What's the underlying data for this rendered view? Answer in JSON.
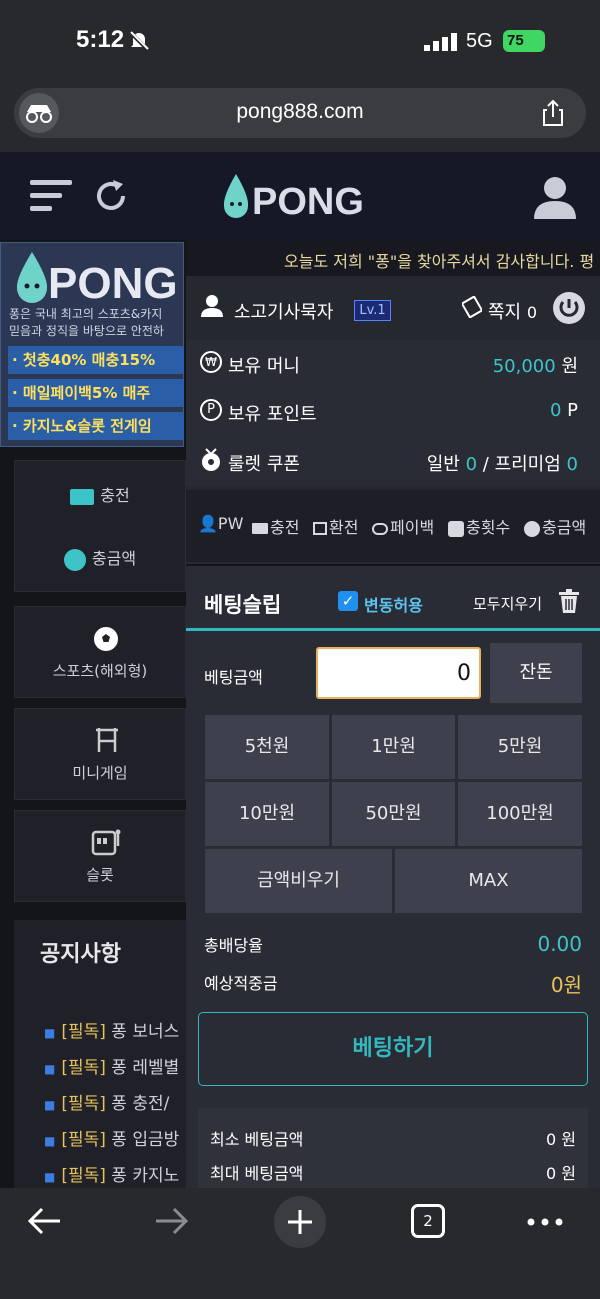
{
  "status_bar": {
    "time": "5:12",
    "network": "5G",
    "battery": "75"
  },
  "browser": {
    "url": "pong888.com",
    "tab_count": "2"
  },
  "site": {
    "logo_text": "PONG"
  },
  "banner": {
    "logo_text": "PONG",
    "line1": "퐁은 국내 최고의 스포츠&카지",
    "line2": "믿음과 정직을 바탕으로 안전하",
    "strips": [
      "· 첫충40% 매충15%",
      "· 매일페이백5% 매주",
      "· 카지노&슬롯 전게임"
    ]
  },
  "left_menu": {
    "charge": "충전",
    "charge_amount": "충금액",
    "sports": "스포츠(해외형)",
    "minigame": "미니게임",
    "slot": "슬롯"
  },
  "notices": {
    "title": "공지사항",
    "items": [
      {
        "tag": "[필독]",
        "text": " 퐁 보너스"
      },
      {
        "tag": "[필독]",
        "text": " 퐁 레벨별"
      },
      {
        "tag": "[필독]",
        "text": " 퐁 충전/"
      },
      {
        "tag": "[필독]",
        "text": " 퐁 입금방"
      },
      {
        "tag": "[필독]",
        "text": " 퐁 카지노"
      }
    ]
  },
  "panel": {
    "marquee": "오늘도 저희 \"퐁\"을 찾아주셔서 감사합니다. 평",
    "username": "소고기사묵자",
    "level": "Lv.1",
    "message_label": "쪽지",
    "message_count": "0",
    "money_label": "보유 머니",
    "money_value": "50,000",
    "money_unit": "원",
    "point_label": "보유 포인트",
    "point_value": "0",
    "point_unit": "P",
    "coupon_label": "룰렛 쿠폰",
    "coupon_general_label": "일반",
    "coupon_general": "0",
    "coupon_sep": "/",
    "coupon_premium_label": "프리미엄",
    "coupon_premium": "0",
    "tools": [
      "PW",
      "충전",
      "환전",
      "페이백",
      "충횟수",
      "충금액"
    ]
  },
  "betslip": {
    "title": "베팅슬립",
    "allow_change_label": "변동허용",
    "clear_all": "모두지우기",
    "amount_label": "베팅금액",
    "amount_value": "0",
    "change_button": "잔돈",
    "quick_amounts": [
      "5천원",
      "1만원",
      "5만원",
      "10만원",
      "50만원",
      "100만원"
    ],
    "clear_amount": "금액비우기",
    "max": "MAX",
    "total_odds_label": "총배당율",
    "total_odds": "0.00",
    "expected_win_label": "예상적중금",
    "expected_win": "0원",
    "bet_button": "베팅하기",
    "min_bet_label": "최소 베팅금액",
    "min_bet": "0 원",
    "max_bet_label": "최대 베팅금액",
    "max_bet": "0 원"
  },
  "colors": {
    "accent": "#33b8be",
    "gold": "#e7c35a",
    "header_bg": "#171827"
  }
}
